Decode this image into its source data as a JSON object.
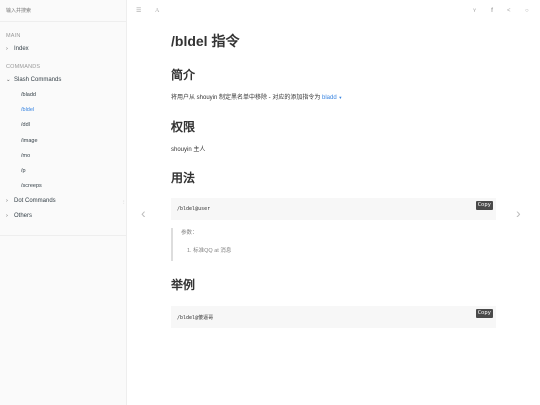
{
  "sidebar": {
    "search_placeholder": "输入并搜索",
    "main_header": "MAIN",
    "index_label": "Index",
    "commands_header": "COMMANDS",
    "slash_label": "Slash Commands",
    "slash_items": [
      "/bladd",
      "/bldel",
      "/ddl",
      "/image",
      "/mo",
      "/p",
      "/screeps"
    ],
    "active_item": "/bldel",
    "dot_label": "Dot Commands",
    "others_label": "Others"
  },
  "header": {
    "icons": [
      "menu-icon",
      "font-icon",
      "twitter-icon",
      "facebook-icon",
      "share-icon",
      "weibo-icon"
    ]
  },
  "page": {
    "title": "/bldel 指令",
    "h_intro": "简介",
    "intro_text": "将用户从 shouyin 制定黑名单中移除 - 对应的添加指令为 ",
    "intro_link": "bladd",
    "h_perm": "权限",
    "perm_text": "shouyin 主人",
    "h_usage": "用法",
    "usage_code": "/bldel@user",
    "copy_label": "Copy",
    "param_label": "参数：",
    "param_item": "1. 标准QQ at 消息",
    "h_example": "举例",
    "example_code": "/bldel@傻逼哥"
  }
}
